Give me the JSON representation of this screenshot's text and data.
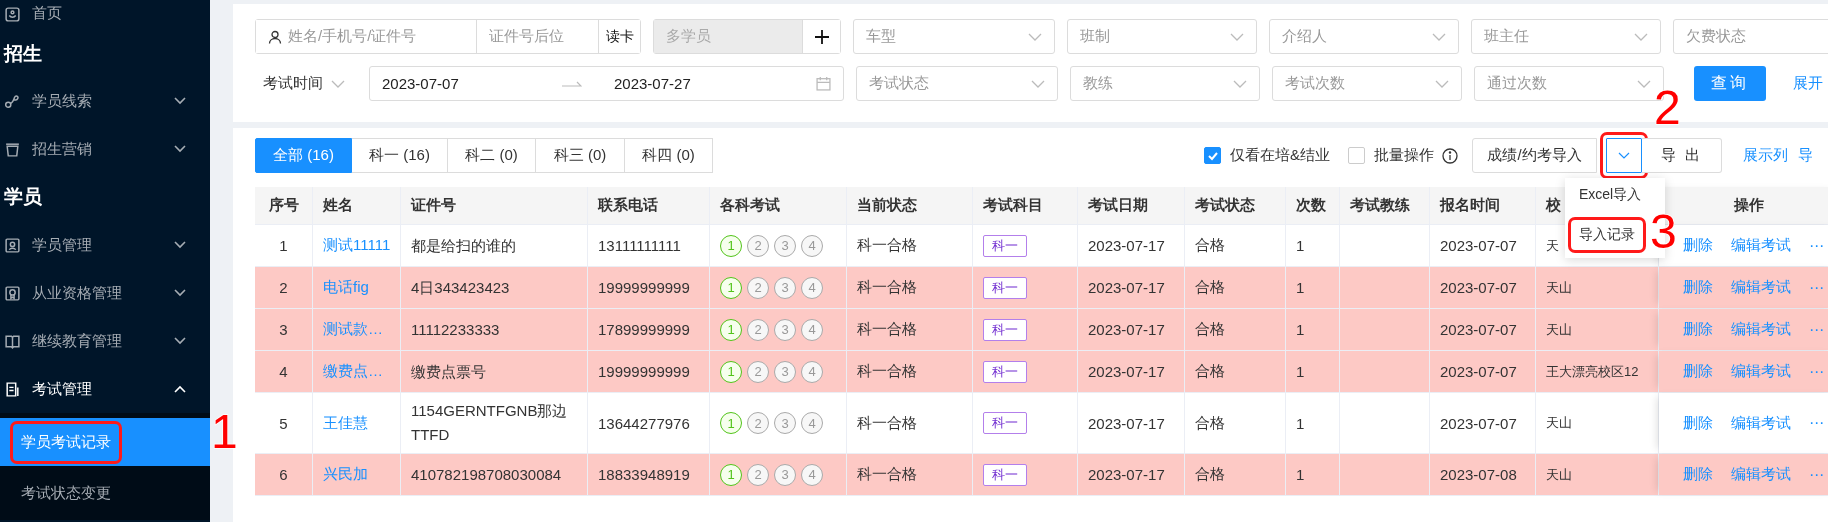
{
  "sidebar": {
    "items": [
      {
        "kind": "link",
        "label": "首页"
      },
      {
        "kind": "heading",
        "label": "招生"
      },
      {
        "kind": "menu",
        "label": "学员线索",
        "expanded": false
      },
      {
        "kind": "menu",
        "label": "招生营销",
        "expanded": false
      },
      {
        "kind": "heading",
        "label": "学员"
      },
      {
        "kind": "menu",
        "label": "学员管理",
        "expanded": false
      },
      {
        "kind": "menu",
        "label": "从业资格管理",
        "expanded": false
      },
      {
        "kind": "menu",
        "label": "继续教育管理",
        "expanded": false
      },
      {
        "kind": "menu",
        "label": "考试管理",
        "expanded": true,
        "children": [
          {
            "label": "学员考试记录",
            "selected": true
          },
          {
            "label": "考试状态变更",
            "selected": false
          }
        ]
      }
    ]
  },
  "filters": {
    "name_search": {
      "placeholder": "姓名/手机号/证件号"
    },
    "id_suffix": {
      "placeholder": "证件号后位"
    },
    "read_card_button": "读卡",
    "multi_student": {
      "placeholder": "多学员",
      "disabled": true
    },
    "row1_selects": [
      {
        "placeholder": "车型"
      },
      {
        "placeholder": "班制"
      },
      {
        "placeholder": "介绍人"
      },
      {
        "placeholder": "班主任"
      },
      {
        "placeholder": "欠费状态"
      }
    ],
    "date_type": "考试时间",
    "date_start": "2023-07-07",
    "date_end": "2023-07-27",
    "row2_selects": [
      {
        "placeholder": "考试状态"
      },
      {
        "placeholder": "教练"
      },
      {
        "placeholder": "考试次数"
      },
      {
        "placeholder": "通过次数"
      }
    ],
    "query_button": "查询",
    "expand_link": "展开"
  },
  "tabs": [
    {
      "label": "全部 (16)",
      "selected": true
    },
    {
      "label": "科一 (16)",
      "selected": false
    },
    {
      "label": "科二 (0)",
      "selected": false
    },
    {
      "label": "科三 (0)",
      "selected": false
    },
    {
      "label": "科四 (0)",
      "selected": false
    }
  ],
  "toolbar": {
    "checkboxes": [
      {
        "label": "仅看在培&结业",
        "checked": true
      },
      {
        "label": "批量操作",
        "checked": false
      }
    ],
    "import_button": "成绩/约考导入",
    "export_button": "导 出",
    "columns_link": "展示列",
    "cut_link": "导"
  },
  "dropdown_menu": {
    "items": [
      {
        "label": "Excel导入"
      },
      {
        "label": "导入记录"
      }
    ]
  },
  "table": {
    "columns": [
      "序号",
      "姓名",
      "证件号",
      "联系电话",
      "各科考试",
      "当前状态",
      "考试科目",
      "考试日期",
      "考试状态",
      "次数",
      "考试教练",
      "报名时间",
      "校",
      "操作"
    ],
    "rows": [
      {
        "highlighted": false,
        "no": "1",
        "name": "测试11111",
        "id_number": "都是给扫的谁的",
        "phone": "13111111111",
        "exams": [
          {
            "label": "1",
            "passed": true
          },
          {
            "label": "2",
            "passed": false
          },
          {
            "label": "3",
            "passed": false
          },
          {
            "label": "4",
            "passed": false
          }
        ],
        "status": "科一合格",
        "subject": "科一",
        "exam_date": "2023-07-17",
        "exam_status": "合格",
        "count": "1",
        "signup_date": "2023-07-07",
        "campus": "天",
        "actions": [
          "删除",
          "编辑考试",
          "⋯"
        ]
      },
      {
        "highlighted": true,
        "no": "2",
        "name": "电话fig",
        "id_number": "4日343423423",
        "phone": "19999999999",
        "exams": [
          {
            "label": "1",
            "passed": true
          },
          {
            "label": "2",
            "passed": false
          },
          {
            "label": "3",
            "passed": false
          },
          {
            "label": "4",
            "passed": false
          }
        ],
        "status": "科一合格",
        "subject": "科一",
        "exam_date": "2023-07-17",
        "exam_status": "合格",
        "count": "1",
        "signup_date": "2023-07-07",
        "campus": "天山",
        "actions": [
          "删除",
          "编辑考试",
          "⋯"
        ]
      },
      {
        "highlighted": true,
        "no": "3",
        "name": "测试款…",
        "id_number": "11112233333",
        "phone": "17899999999",
        "exams": [
          {
            "label": "1",
            "passed": true
          },
          {
            "label": "2",
            "passed": false
          },
          {
            "label": "3",
            "passed": false
          },
          {
            "label": "4",
            "passed": false
          }
        ],
        "status": "科一合格",
        "subject": "科一",
        "exam_date": "2023-07-17",
        "exam_status": "合格",
        "count": "1",
        "signup_date": "2023-07-07",
        "campus": "天山",
        "actions": [
          "删除",
          "编辑考试",
          "⋯"
        ]
      },
      {
        "highlighted": true,
        "no": "4",
        "name": "缴费点…",
        "id_number": "缴费点票号",
        "phone": "19999999999",
        "exams": [
          {
            "label": "1",
            "passed": true
          },
          {
            "label": "2",
            "passed": false
          },
          {
            "label": "3",
            "passed": false
          },
          {
            "label": "4",
            "passed": false
          }
        ],
        "status": "科一合格",
        "subject": "科一",
        "exam_date": "2023-07-17",
        "exam_status": "合格",
        "count": "1",
        "signup_date": "2023-07-07",
        "campus": "王大漂亮校区12",
        "actions": [
          "删除",
          "编辑考试",
          "⋯"
        ]
      },
      {
        "highlighted": false,
        "no": "5",
        "name": "王佳慧",
        "id_number": "1154GERNTFGNB那边TTFD",
        "phone": "13644277976",
        "exams": [
          {
            "label": "1",
            "passed": true
          },
          {
            "label": "2",
            "passed": false
          },
          {
            "label": "3",
            "passed": false
          },
          {
            "label": "4",
            "passed": false
          }
        ],
        "status": "科一合格",
        "subject": "科一",
        "exam_date": "2023-07-17",
        "exam_status": "合格",
        "count": "1",
        "signup_date": "2023-07-07",
        "campus": "天山",
        "actions": [
          "删除",
          "编辑考试",
          "⋯"
        ]
      },
      {
        "highlighted": true,
        "no": "6",
        "name": "兴民加",
        "id_number": "410782198708030084",
        "phone": "18833948919",
        "exams": [
          {
            "label": "1",
            "passed": true
          },
          {
            "label": "2",
            "passed": false
          },
          {
            "label": "3",
            "passed": false
          },
          {
            "label": "4",
            "passed": false
          }
        ],
        "status": "科一合格",
        "subject": "科一",
        "exam_date": "2023-07-17",
        "exam_status": "合格",
        "count": "1",
        "signup_date": "2023-07-08",
        "campus": "天山",
        "actions": [
          "删除",
          "编辑考试",
          "⋯"
        ]
      }
    ]
  },
  "annotations": [
    {
      "label": "1"
    },
    {
      "label": "2"
    },
    {
      "label": "3"
    }
  ]
}
